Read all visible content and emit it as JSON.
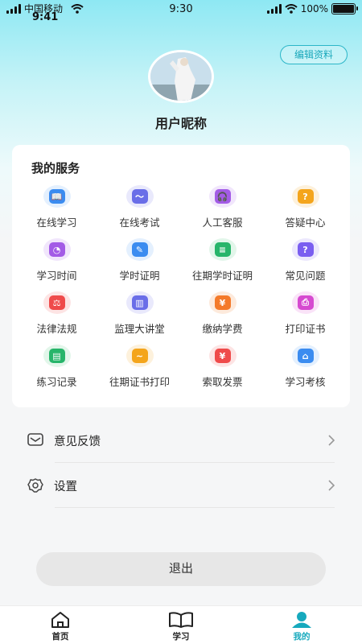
{
  "status_bar": {
    "carrier": "中国移动",
    "time_left": "9:41",
    "time_center": "9:30",
    "battery": "100%",
    "battery_level": 1.0
  },
  "profile": {
    "edit_label": "编辑资料",
    "nickname": "用户昵称",
    "avatar_icon": "avatar-photo"
  },
  "services": {
    "title": "我的服务",
    "items": [
      {
        "label": "在线学习",
        "icon": "book-icon",
        "color": "#3b8cf0",
        "bg": "#e4f0fe",
        "glyph": "📖"
      },
      {
        "label": "在线考试",
        "icon": "exam-icon",
        "color": "#6a6ee8",
        "bg": "#e9e9fc",
        "glyph": "〜"
      },
      {
        "label": "人工客服",
        "icon": "headset-icon",
        "color": "#a35be6",
        "bg": "#f1e6fc",
        "glyph": "🎧"
      },
      {
        "label": "答疑中心",
        "icon": "qa-icon",
        "color": "#f4a51c",
        "bg": "#fdf1dc",
        "glyph": "?"
      },
      {
        "label": "学习时间",
        "icon": "clock-icon",
        "color": "#a35be6",
        "bg": "#f1e6fc",
        "glyph": "◔"
      },
      {
        "label": "学时证明",
        "icon": "certificate-edit-icon",
        "color": "#3b8cf0",
        "bg": "#e4f0fe",
        "glyph": "✎"
      },
      {
        "label": "往期学时证明",
        "icon": "document-icon",
        "color": "#27b56a",
        "bg": "#e2f6ea",
        "glyph": "≡"
      },
      {
        "label": "常见问题",
        "icon": "question-icon",
        "color": "#7a5ef0",
        "bg": "#ece8fd",
        "glyph": "?"
      },
      {
        "label": "法律法规",
        "icon": "gavel-icon",
        "color": "#ef4b4b",
        "bg": "#fde4e4",
        "glyph": "⚖"
      },
      {
        "label": "监理大讲堂",
        "icon": "lecture-chart-icon",
        "color": "#6a6ee8",
        "bg": "#e9e9fc",
        "glyph": "▥"
      },
      {
        "label": "缴纳学费",
        "icon": "payment-icon",
        "color": "#f47a2a",
        "bg": "#fdeadc",
        "glyph": "¥"
      },
      {
        "label": "打印证书",
        "icon": "printer-icon",
        "color": "#d64ad0",
        "bg": "#fae3f8",
        "glyph": "⎙"
      },
      {
        "label": "练习记录",
        "icon": "record-icon",
        "color": "#27b56a",
        "bg": "#e2f6ea",
        "glyph": "▤"
      },
      {
        "label": "往期证书打印",
        "icon": "certificate-print-icon",
        "color": "#f4a51c",
        "bg": "#fdf1dc",
        "glyph": "~"
      },
      {
        "label": "索取发票",
        "icon": "invoice-icon",
        "color": "#ef4b4b",
        "bg": "#fde4e4",
        "glyph": "¥"
      },
      {
        "label": "学习考核",
        "icon": "assessment-board-icon",
        "color": "#3b8cf0",
        "bg": "#e4f0fe",
        "glyph": "⌂"
      }
    ]
  },
  "menu": {
    "feedback_label": "意见反馈",
    "settings_label": "设置"
  },
  "logout_label": "退出",
  "tabs": [
    {
      "label": "首页",
      "icon": "home-icon"
    },
    {
      "label": "学习",
      "icon": "open-book-icon"
    },
    {
      "label": "我的",
      "icon": "user-icon"
    }
  ],
  "accent_color": "#16a9bd"
}
